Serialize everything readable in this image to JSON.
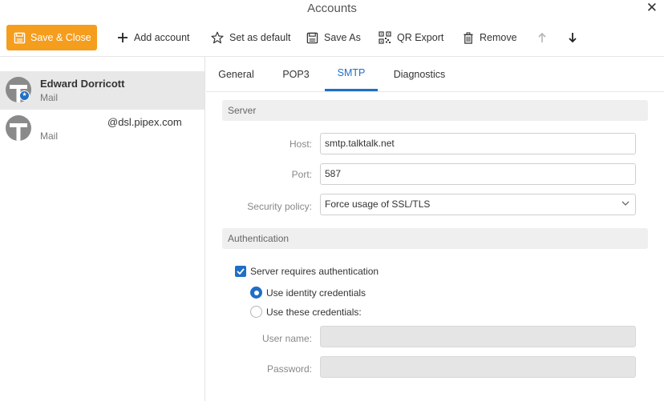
{
  "window": {
    "title": "Accounts",
    "close_glyph": "✕"
  },
  "toolbar": {
    "save_close": "Save & Close",
    "add_account": "Add account",
    "set_default": "Set as default",
    "save_as": "Save As",
    "qr_export": "QR Export",
    "remove": "Remove"
  },
  "accounts": [
    {
      "name": "Edward Dorricott",
      "type": "Mail",
      "selected": true,
      "default_badge": "★"
    },
    {
      "name": "@dsl.pipex.com",
      "type": "Mail",
      "selected": false
    }
  ],
  "tabs": [
    "General",
    "POP3",
    "SMTP",
    "Diagnostics"
  ],
  "active_tab": "SMTP",
  "server": {
    "header": "Server",
    "host_label": "Host:",
    "host_value": "smtp.talktalk.net",
    "port_label": "Port:",
    "port_value": "587",
    "security_label": "Security policy:",
    "security_value": "Force usage of SSL/TLS"
  },
  "authentication": {
    "header": "Authentication",
    "requires_auth_label": "Server requires authentication",
    "requires_auth_checked": true,
    "identity_label": "Use identity credentials",
    "custom_label": "Use these credentials:",
    "selected_option": "identity",
    "username_label": "User name:",
    "username_value": "",
    "password_label": "Password:",
    "password_value": ""
  },
  "colors": {
    "accent": "#1f6fc5",
    "save_button": "#f59d1c"
  }
}
